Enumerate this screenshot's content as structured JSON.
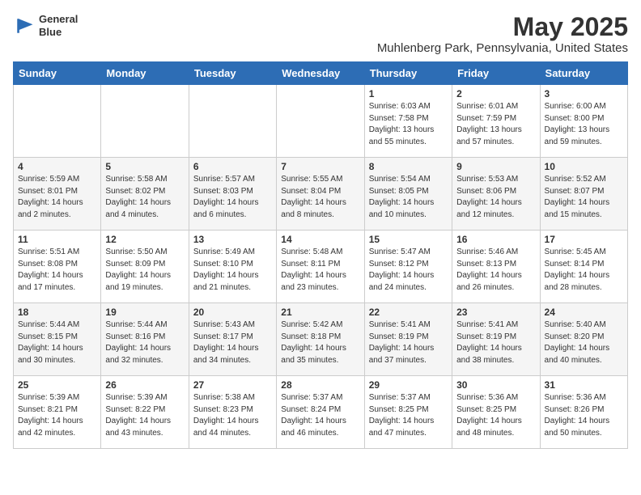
{
  "header": {
    "logo_line1": "General",
    "logo_line2": "Blue",
    "title": "May 2025",
    "subtitle": "Muhlenberg Park, Pennsylvania, United States"
  },
  "columns": [
    "Sunday",
    "Monday",
    "Tuesday",
    "Wednesday",
    "Thursday",
    "Friday",
    "Saturday"
  ],
  "weeks": [
    [
      {
        "day": "",
        "info": ""
      },
      {
        "day": "",
        "info": ""
      },
      {
        "day": "",
        "info": ""
      },
      {
        "day": "",
        "info": ""
      },
      {
        "day": "1",
        "info": "Sunrise: 6:03 AM\nSunset: 7:58 PM\nDaylight: 13 hours\nand 55 minutes."
      },
      {
        "day": "2",
        "info": "Sunrise: 6:01 AM\nSunset: 7:59 PM\nDaylight: 13 hours\nand 57 minutes."
      },
      {
        "day": "3",
        "info": "Sunrise: 6:00 AM\nSunset: 8:00 PM\nDaylight: 13 hours\nand 59 minutes."
      }
    ],
    [
      {
        "day": "4",
        "info": "Sunrise: 5:59 AM\nSunset: 8:01 PM\nDaylight: 14 hours\nand 2 minutes."
      },
      {
        "day": "5",
        "info": "Sunrise: 5:58 AM\nSunset: 8:02 PM\nDaylight: 14 hours\nand 4 minutes."
      },
      {
        "day": "6",
        "info": "Sunrise: 5:57 AM\nSunset: 8:03 PM\nDaylight: 14 hours\nand 6 minutes."
      },
      {
        "day": "7",
        "info": "Sunrise: 5:55 AM\nSunset: 8:04 PM\nDaylight: 14 hours\nand 8 minutes."
      },
      {
        "day": "8",
        "info": "Sunrise: 5:54 AM\nSunset: 8:05 PM\nDaylight: 14 hours\nand 10 minutes."
      },
      {
        "day": "9",
        "info": "Sunrise: 5:53 AM\nSunset: 8:06 PM\nDaylight: 14 hours\nand 12 minutes."
      },
      {
        "day": "10",
        "info": "Sunrise: 5:52 AM\nSunset: 8:07 PM\nDaylight: 14 hours\nand 15 minutes."
      }
    ],
    [
      {
        "day": "11",
        "info": "Sunrise: 5:51 AM\nSunset: 8:08 PM\nDaylight: 14 hours\nand 17 minutes."
      },
      {
        "day": "12",
        "info": "Sunrise: 5:50 AM\nSunset: 8:09 PM\nDaylight: 14 hours\nand 19 minutes."
      },
      {
        "day": "13",
        "info": "Sunrise: 5:49 AM\nSunset: 8:10 PM\nDaylight: 14 hours\nand 21 minutes."
      },
      {
        "day": "14",
        "info": "Sunrise: 5:48 AM\nSunset: 8:11 PM\nDaylight: 14 hours\nand 23 minutes."
      },
      {
        "day": "15",
        "info": "Sunrise: 5:47 AM\nSunset: 8:12 PM\nDaylight: 14 hours\nand 24 minutes."
      },
      {
        "day": "16",
        "info": "Sunrise: 5:46 AM\nSunset: 8:13 PM\nDaylight: 14 hours\nand 26 minutes."
      },
      {
        "day": "17",
        "info": "Sunrise: 5:45 AM\nSunset: 8:14 PM\nDaylight: 14 hours\nand 28 minutes."
      }
    ],
    [
      {
        "day": "18",
        "info": "Sunrise: 5:44 AM\nSunset: 8:15 PM\nDaylight: 14 hours\nand 30 minutes."
      },
      {
        "day": "19",
        "info": "Sunrise: 5:44 AM\nSunset: 8:16 PM\nDaylight: 14 hours\nand 32 minutes."
      },
      {
        "day": "20",
        "info": "Sunrise: 5:43 AM\nSunset: 8:17 PM\nDaylight: 14 hours\nand 34 minutes."
      },
      {
        "day": "21",
        "info": "Sunrise: 5:42 AM\nSunset: 8:18 PM\nDaylight: 14 hours\nand 35 minutes."
      },
      {
        "day": "22",
        "info": "Sunrise: 5:41 AM\nSunset: 8:19 PM\nDaylight: 14 hours\nand 37 minutes."
      },
      {
        "day": "23",
        "info": "Sunrise: 5:41 AM\nSunset: 8:19 PM\nDaylight: 14 hours\nand 38 minutes."
      },
      {
        "day": "24",
        "info": "Sunrise: 5:40 AM\nSunset: 8:20 PM\nDaylight: 14 hours\nand 40 minutes."
      }
    ],
    [
      {
        "day": "25",
        "info": "Sunrise: 5:39 AM\nSunset: 8:21 PM\nDaylight: 14 hours\nand 42 minutes."
      },
      {
        "day": "26",
        "info": "Sunrise: 5:39 AM\nSunset: 8:22 PM\nDaylight: 14 hours\nand 43 minutes."
      },
      {
        "day": "27",
        "info": "Sunrise: 5:38 AM\nSunset: 8:23 PM\nDaylight: 14 hours\nand 44 minutes."
      },
      {
        "day": "28",
        "info": "Sunrise: 5:37 AM\nSunset: 8:24 PM\nDaylight: 14 hours\nand 46 minutes."
      },
      {
        "day": "29",
        "info": "Sunrise: 5:37 AM\nSunset: 8:25 PM\nDaylight: 14 hours\nand 47 minutes."
      },
      {
        "day": "30",
        "info": "Sunrise: 5:36 AM\nSunset: 8:25 PM\nDaylight: 14 hours\nand 48 minutes."
      },
      {
        "day": "31",
        "info": "Sunrise: 5:36 AM\nSunset: 8:26 PM\nDaylight: 14 hours\nand 50 minutes."
      }
    ]
  ]
}
